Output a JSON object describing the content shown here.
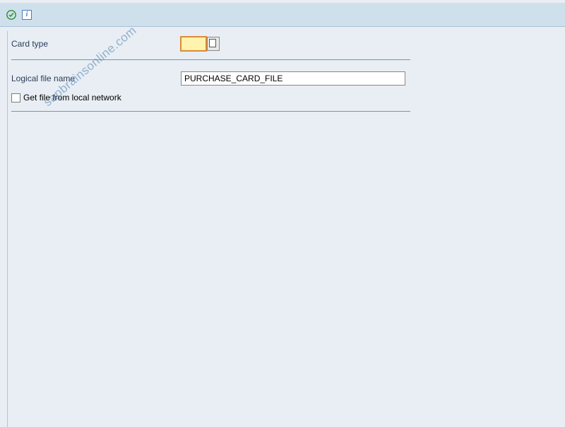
{
  "toolbar": {
    "execute_icon": "execute",
    "info_label": "i"
  },
  "fields": {
    "card_type": {
      "label": "Card type",
      "value": ""
    },
    "logical_file_name": {
      "label": "Logical file name",
      "value": "PURCHASE_CARD_FILE"
    },
    "get_file_local": {
      "label": "Get file from local network",
      "checked": false
    }
  },
  "watermark": "sapbrainsonline.com"
}
